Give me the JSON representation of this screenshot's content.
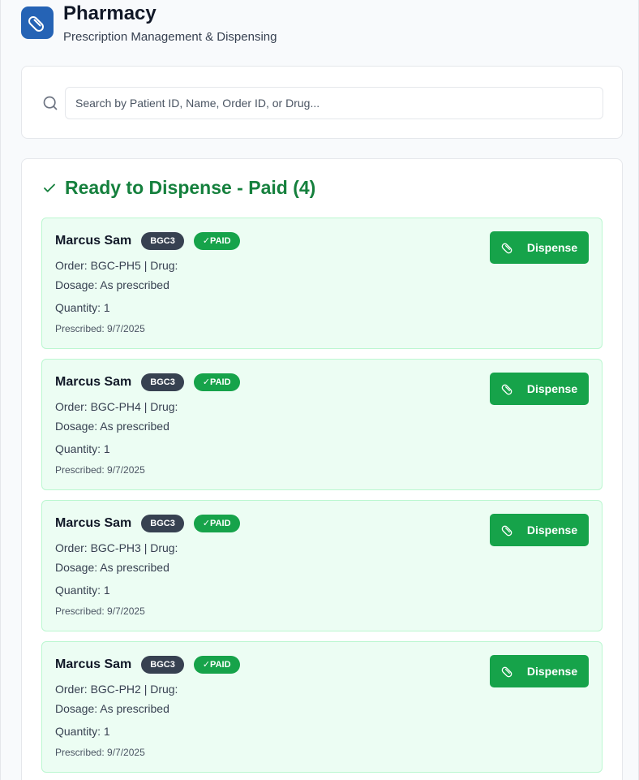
{
  "header": {
    "title": "Pharmacy",
    "subtitle": "Prescription Management & Dispensing",
    "logo_icon": "pill-icon"
  },
  "search": {
    "placeholder": "Search by Patient ID, Name, Order ID, or Drug...",
    "value": ""
  },
  "section": {
    "title": "Ready to Dispense - Paid (4)"
  },
  "prescriptions": [
    {
      "name": "Marcus Sam",
      "patient_id": "BGC3",
      "paid": "✓PAID",
      "order": "Order: BGC-PH5 | Drug:",
      "dosage": "Dosage: As prescribed",
      "quantity": "Quantity: 1",
      "prescribed": "Prescribed: 9/7/2025",
      "action": "Dispense"
    },
    {
      "name": "Marcus Sam",
      "patient_id": "BGC3",
      "paid": "✓PAID",
      "order": "Order: BGC-PH4 | Drug:",
      "dosage": "Dosage: As prescribed",
      "quantity": "Quantity: 1",
      "prescribed": "Prescribed: 9/7/2025",
      "action": "Dispense"
    },
    {
      "name": "Marcus Sam",
      "patient_id": "BGC3",
      "paid": "✓PAID",
      "order": "Order: BGC-PH3 | Drug:",
      "dosage": "Dosage: As prescribed",
      "quantity": "Quantity: 1",
      "prescribed": "Prescribed: 9/7/2025",
      "action": "Dispense"
    },
    {
      "name": "Marcus Sam",
      "patient_id": "BGC3",
      "paid": "✓PAID",
      "order": "Order: BGC-PH2 | Drug:",
      "dosage": "Dosage: As prescribed",
      "quantity": "Quantity: 1",
      "prescribed": "Prescribed: 9/7/2025",
      "action": "Dispense"
    }
  ],
  "colors": {
    "brand": "#2563b5",
    "success": "#16a34a",
    "success_text": "#15803d",
    "card_bg": "#ecfdf3",
    "badge_dark": "#374151"
  }
}
